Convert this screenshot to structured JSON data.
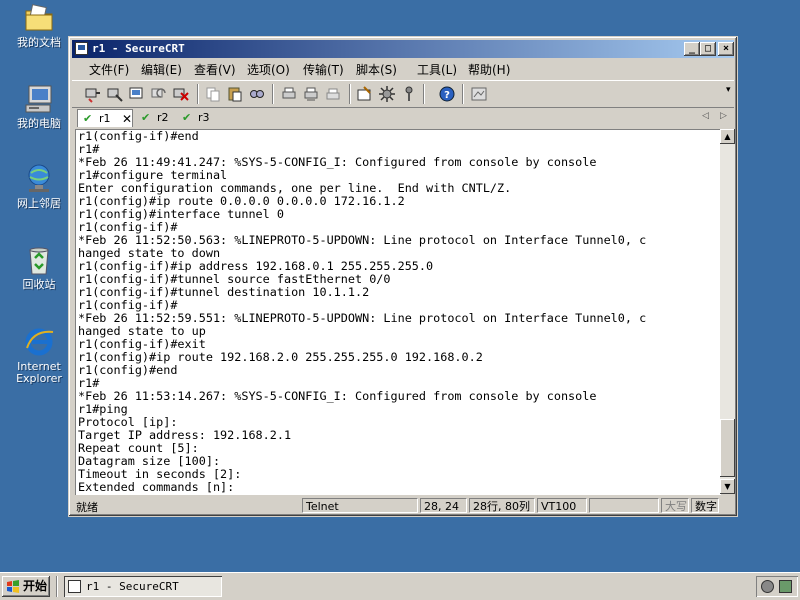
{
  "desktop": {
    "icons": [
      {
        "label": "我的文档",
        "icon": "folder-documents-icon"
      },
      {
        "label": "我的电脑",
        "icon": "computer-icon"
      },
      {
        "label": "网上邻居",
        "icon": "network-icon"
      },
      {
        "label": "回收站",
        "icon": "recycle-bin-icon"
      },
      {
        "label_line1": "Internet",
        "label_line2": "Explorer",
        "icon": "internet-explorer-icon"
      }
    ]
  },
  "window": {
    "title": "r1 - SecureCRT",
    "menu": [
      "文件(F)",
      "编辑(E)",
      "查看(V)",
      "选项(O)",
      "传输(T)",
      "脚本(S)",
      "工具(L)",
      "帮助(H)"
    ],
    "tabs": [
      {
        "label": "r1",
        "active": true
      },
      {
        "label": "r2",
        "active": false
      },
      {
        "label": "r3",
        "active": false
      }
    ],
    "terminal_lines": [
      "r1(config-if)#end",
      "r1#",
      "*Feb 26 11:49:41.247: %SYS-5-CONFIG_I: Configured from console by console",
      "r1#configure terminal",
      "Enter configuration commands, one per line.  End with CNTL/Z.",
      "r1(config)#ip route 0.0.0.0 0.0.0.0 172.16.1.2",
      "r1(config)#interface tunnel 0",
      "r1(config-if)#",
      "*Feb 26 11:52:50.563: %LINEPROTO-5-UPDOWN: Line protocol on Interface Tunnel0, c",
      "hanged state to down",
      "r1(config-if)#ip address 192.168.0.1 255.255.255.0",
      "r1(config-if)#tunnel source fastEthernet 0/0",
      "r1(config-if)#tunnel destination 10.1.1.2",
      "r1(config-if)#",
      "*Feb 26 11:52:59.551: %LINEPROTO-5-UPDOWN: Line protocol on Interface Tunnel0, c",
      "hanged state to up",
      "r1(config-if)#exit",
      "r1(config)#ip route 192.168.2.0 255.255.255.0 192.168.0.2",
      "r1(config)#end",
      "r1#",
      "*Feb 26 11:53:14.267: %SYS-5-CONFIG_I: Configured from console by console",
      "r1#ping",
      "Protocol [ip]:",
      "Target IP address: 192.168.2.1",
      "Repeat count [5]:",
      "Datagram size [100]:",
      "Timeout in seconds [2]:",
      "Extended commands [n]:"
    ],
    "status": {
      "ready": "就绪",
      "protocol": "Telnet",
      "cursor": "28, 24",
      "size": "28行, 80列",
      "emulation": "VT100",
      "caps": "大写",
      "num": "数字"
    }
  },
  "taskbar": {
    "start_label": "开始",
    "task_label": "r1 - SecureCRT"
  },
  "colors": {
    "desktop": "#3a6ea5",
    "titlebar_start": "#0a246a",
    "titlebar_end": "#a6caf0",
    "face": "#d4d0c8",
    "tab_check": "#2a9a2a"
  }
}
